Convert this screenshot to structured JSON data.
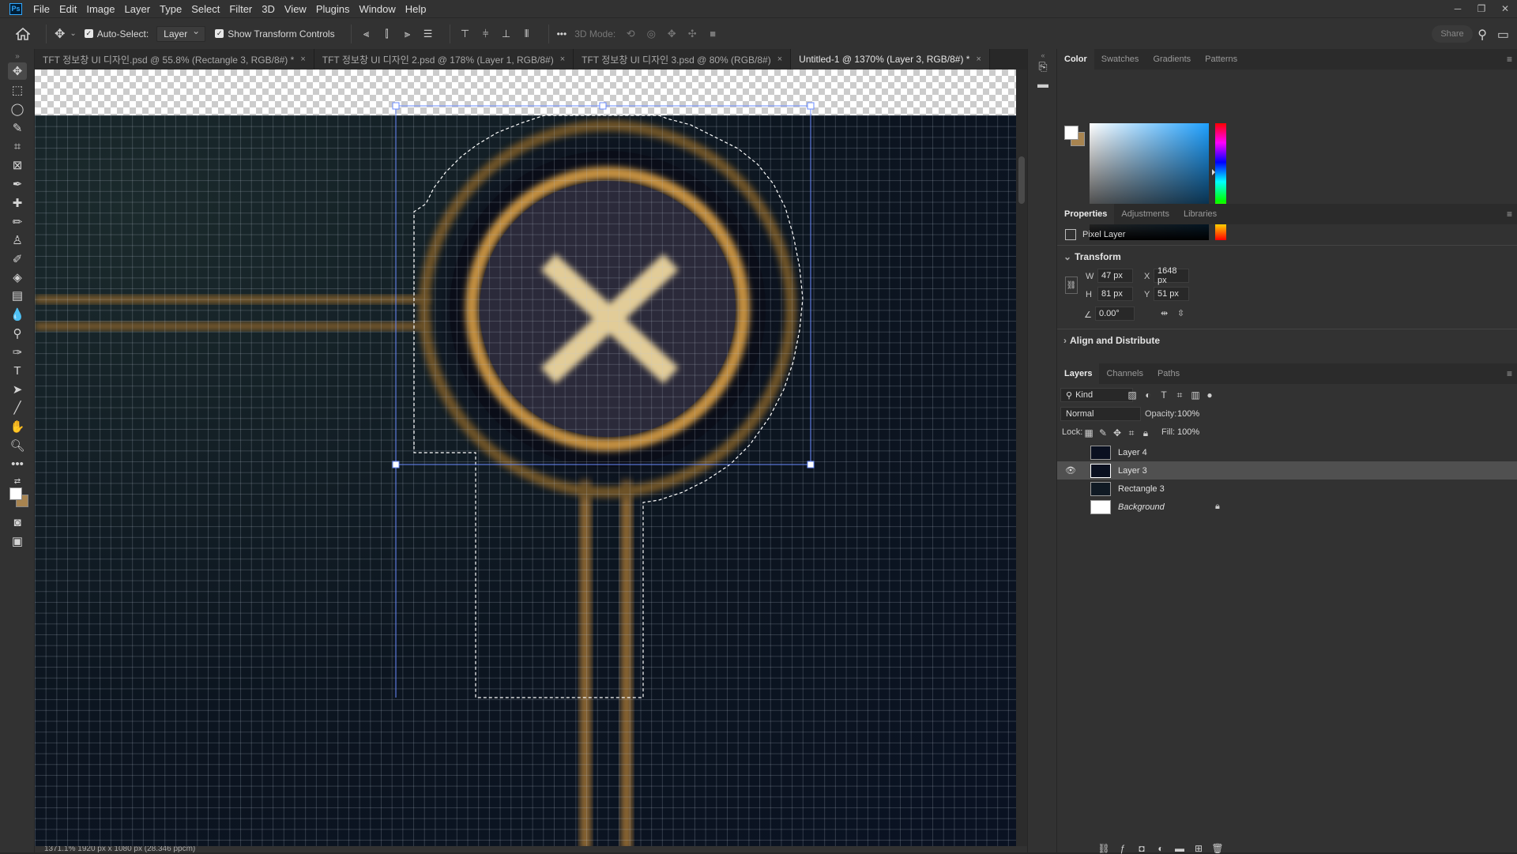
{
  "app": {
    "logo": "Ps"
  },
  "menu": [
    "File",
    "Edit",
    "Image",
    "Layer",
    "Type",
    "Select",
    "Filter",
    "3D",
    "View",
    "Plugins",
    "Window",
    "Help"
  ],
  "window_controls": {
    "minimize": "─",
    "restore": "❐",
    "close": "✕"
  },
  "options_bar": {
    "auto_select_label": "Auto-Select:",
    "auto_select_checked": true,
    "auto_select_target": "Layer",
    "show_transform_label": "Show Transform Controls",
    "show_transform_checked": true,
    "more": "•••",
    "mode_3d_label": "3D Mode:",
    "share_label": "Share"
  },
  "tabs": [
    {
      "label": "TFT 정보창 UI 디자인.psd @ 55.8% (Rectangle 3, RGB/8#) *",
      "active": false
    },
    {
      "label": "TFT 정보창 UI 디자인 2.psd @ 178% (Layer 1, RGB/8#)",
      "active": false
    },
    {
      "label": "TFT 정보창 UI 디자인 3.psd @ 80% (RGB/8#)",
      "active": false
    },
    {
      "label": "Untitled-1 @ 1370% (Layer 3, RGB/8#) *",
      "active": true
    }
  ],
  "tab_close": "×",
  "status_bar": {
    "text": "1371.1%   1920 px x 1080 px (28.346 ppcm)"
  },
  "color_panel": {
    "tabs": [
      "Color",
      "Swatches",
      "Gradients",
      "Patterns"
    ],
    "active_tab": "Color",
    "foreground": "#ffffff",
    "background": "#a88450"
  },
  "properties_panel": {
    "tabs": [
      "Properties",
      "Adjustments",
      "Libraries"
    ],
    "active_tab": "Properties",
    "layer_type": "Pixel Layer",
    "transform_title": "Transform",
    "w_label": "W",
    "w": "47 px",
    "h_label": "H",
    "h": "81 px",
    "x_label": "X",
    "x": "1648 px",
    "y_label": "Y",
    "y": "51 px",
    "angle": "0.00°",
    "align_title": "Align and Distribute"
  },
  "layers_panel": {
    "tabs": [
      "Layers",
      "Channels",
      "Paths"
    ],
    "active_tab": "Layers",
    "filter_kind": "Kind",
    "blend_mode": "Normal",
    "opacity_label": "Opacity:",
    "opacity": "100%",
    "lock_label": "Lock:",
    "fill_label": "Fill:",
    "fill": "100%",
    "layers": [
      {
        "name": "Layer 4",
        "visible": false,
        "selected": false,
        "italic": false,
        "locked": false
      },
      {
        "name": "Layer 3",
        "visible": true,
        "selected": true,
        "italic": false,
        "locked": false
      },
      {
        "name": "Rectangle 3",
        "visible": false,
        "selected": false,
        "italic": false,
        "locked": false
      },
      {
        "name": "Background",
        "visible": false,
        "selected": false,
        "italic": true,
        "locked": true
      }
    ]
  },
  "colors": {
    "gold": "#b8873a",
    "gold_light": "#e8d4a0",
    "dark_navy": "#0a1222",
    "circle_fill": "#2a2a3c",
    "ui_bg": "#323232",
    "selection_blue": "#6b8cff"
  }
}
